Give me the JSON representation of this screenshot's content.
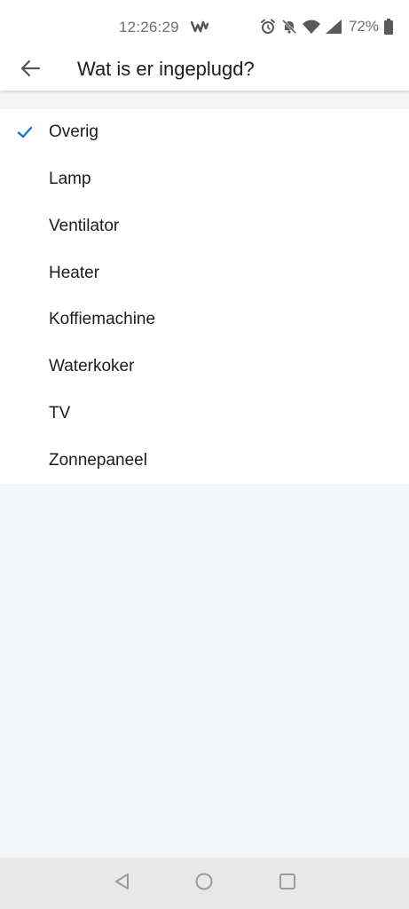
{
  "status_bar": {
    "time": "12:26:29",
    "app_icon": "w-app-icon",
    "icons": [
      "alarm-icon",
      "bell-muted-icon",
      "wifi-icon",
      "signal-icon"
    ],
    "battery_percent": "72%",
    "battery_icon": "battery-icon"
  },
  "app_bar": {
    "back_icon": "arrow-left-icon",
    "title": "Wat is er ingeplugd?"
  },
  "options": [
    {
      "label": "Overig",
      "selected": true
    },
    {
      "label": "Lamp",
      "selected": false
    },
    {
      "label": "Ventilator",
      "selected": false
    },
    {
      "label": "Heater",
      "selected": false
    },
    {
      "label": "Koffiemachine",
      "selected": false
    },
    {
      "label": "Waterkoker",
      "selected": false
    },
    {
      "label": "TV",
      "selected": false
    },
    {
      "label": "Zonnepaneel",
      "selected": false
    }
  ],
  "nav_bar": {
    "back_icon": "triangle-back-icon",
    "home_icon": "circle-home-icon",
    "recents_icon": "square-recents-icon"
  },
  "colors": {
    "accent_check": "#1976d2",
    "background": "#f4f5f7",
    "surface": "#ffffff",
    "nav_bar": "#e8e8e8"
  }
}
